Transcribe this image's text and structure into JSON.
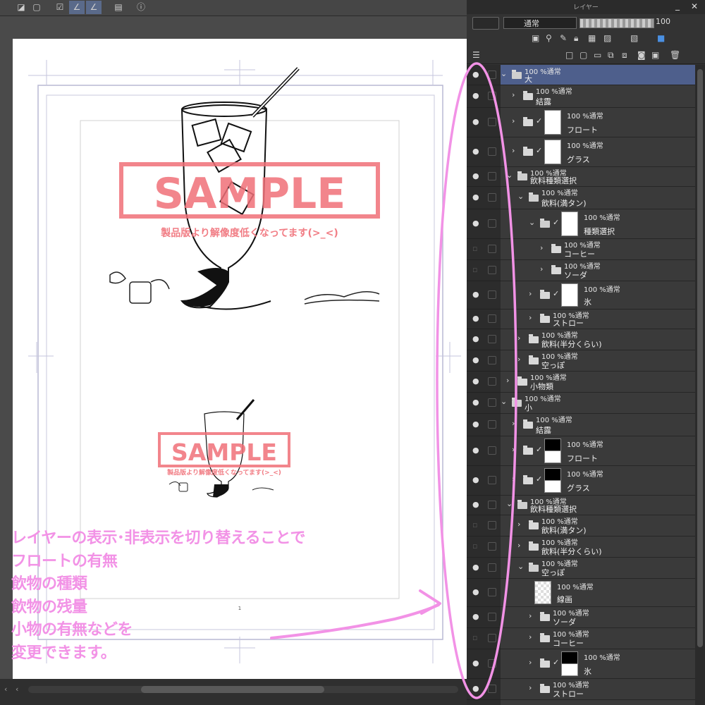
{
  "panel": {
    "title": "レイヤー",
    "blend_mode": "通常",
    "opacity": "100"
  },
  "canvas": {
    "watermark_big": "SAMPLE",
    "watermark_big_sub": "製品版より解像度低くなってます(>_<)",
    "watermark_small": "SAMPLE",
    "watermark_small_sub": "製品版より解像度低くなってます(>_<)",
    "page_number": "1"
  },
  "annotation": {
    "lines": [
      "レイヤーの表示･非表示を切り替えることで",
      "フロートの有無",
      "飲物の種類",
      "飲物の残量",
      "小物の有無などを",
      "変更できます。"
    ]
  },
  "layers": [
    {
      "meta": "100 %通常",
      "name": "大",
      "selected": true
    },
    {
      "meta": "100 %通常",
      "name": "結露"
    },
    {
      "meta": "100 %通常",
      "name": "フロート"
    },
    {
      "meta": "100 %通常",
      "name": "グラス"
    },
    {
      "meta": "100 %通常",
      "name": "飲料種類選択"
    },
    {
      "meta": "100 %通常",
      "name": "飲料(満タン)"
    },
    {
      "meta": "100 %通常",
      "name": "種類選択"
    },
    {
      "meta": "100 %通常",
      "name": "コーヒー"
    },
    {
      "meta": "100 %通常",
      "name": "ソーダ"
    },
    {
      "meta": "100 %通常",
      "name": "氷"
    },
    {
      "meta": "100 %通常",
      "name": "ストロー"
    },
    {
      "meta": "100 %通常",
      "name": "飲料(半分くらい)"
    },
    {
      "meta": "100 %通常",
      "name": "空っぽ"
    },
    {
      "meta": "100 %通常",
      "name": "小物類"
    },
    {
      "meta": "100 %通常",
      "name": "小"
    },
    {
      "meta": "100 %通常",
      "name": "結露"
    },
    {
      "meta": "100 %通常",
      "name": "フロート"
    },
    {
      "meta": "100 %通常",
      "name": "グラス"
    },
    {
      "meta": "100 %通常",
      "name": "飲料種類選択"
    },
    {
      "meta": "100 %通常",
      "name": "飲料(満タン)"
    },
    {
      "meta": "100 %通常",
      "name": "飲料(半分くらい)"
    },
    {
      "meta": "100 %通常",
      "name": "空っぽ"
    },
    {
      "meta": "100 %通常",
      "name": "線画"
    },
    {
      "meta": "100 %通常",
      "name": "ソーダ"
    },
    {
      "meta": "100 %通常",
      "name": "コーヒー"
    },
    {
      "meta": "100 %通常",
      "name": "氷"
    },
    {
      "meta": "100 %通常",
      "name": "ストロー"
    }
  ]
}
